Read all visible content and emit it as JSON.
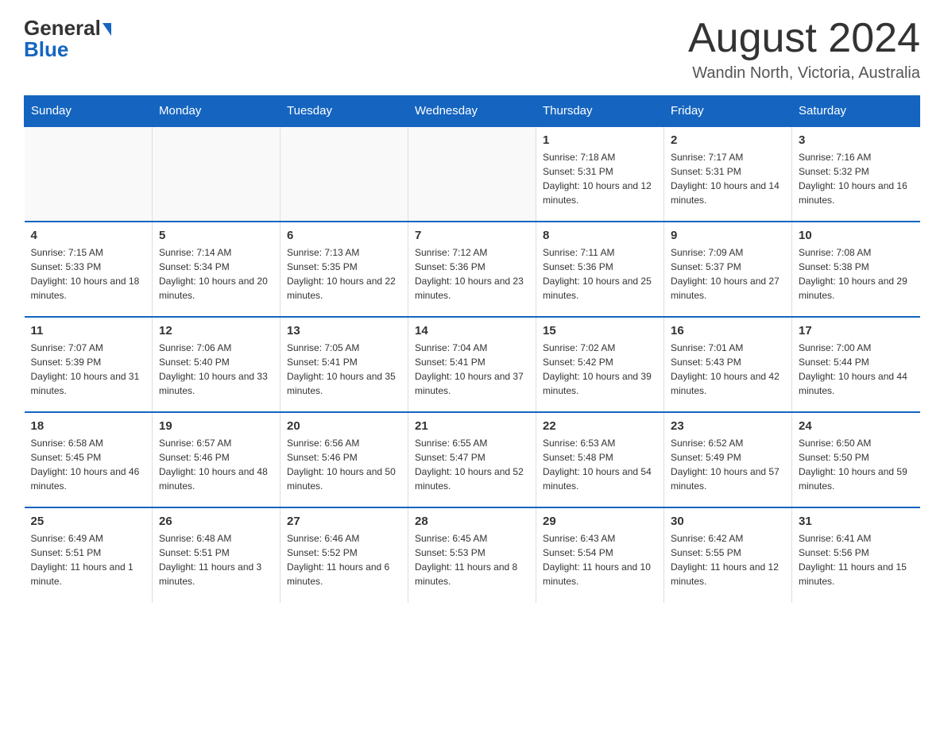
{
  "header": {
    "logo_general": "General",
    "logo_blue": "Blue",
    "month_title": "August 2024",
    "location": "Wandin North, Victoria, Australia"
  },
  "days_of_week": [
    "Sunday",
    "Monday",
    "Tuesday",
    "Wednesday",
    "Thursday",
    "Friday",
    "Saturday"
  ],
  "weeks": [
    {
      "cells": [
        {
          "day": "",
          "sunrise": "",
          "sunset": "",
          "daylight": "",
          "empty": true
        },
        {
          "day": "",
          "sunrise": "",
          "sunset": "",
          "daylight": "",
          "empty": true
        },
        {
          "day": "",
          "sunrise": "",
          "sunset": "",
          "daylight": "",
          "empty": true
        },
        {
          "day": "",
          "sunrise": "",
          "sunset": "",
          "daylight": "",
          "empty": true
        },
        {
          "day": "1",
          "sunrise": "Sunrise: 7:18 AM",
          "sunset": "Sunset: 5:31 PM",
          "daylight": "Daylight: 10 hours and 12 minutes.",
          "empty": false
        },
        {
          "day": "2",
          "sunrise": "Sunrise: 7:17 AM",
          "sunset": "Sunset: 5:31 PM",
          "daylight": "Daylight: 10 hours and 14 minutes.",
          "empty": false
        },
        {
          "day": "3",
          "sunrise": "Sunrise: 7:16 AM",
          "sunset": "Sunset: 5:32 PM",
          "daylight": "Daylight: 10 hours and 16 minutes.",
          "empty": false
        }
      ]
    },
    {
      "cells": [
        {
          "day": "4",
          "sunrise": "Sunrise: 7:15 AM",
          "sunset": "Sunset: 5:33 PM",
          "daylight": "Daylight: 10 hours and 18 minutes.",
          "empty": false
        },
        {
          "day": "5",
          "sunrise": "Sunrise: 7:14 AM",
          "sunset": "Sunset: 5:34 PM",
          "daylight": "Daylight: 10 hours and 20 minutes.",
          "empty": false
        },
        {
          "day": "6",
          "sunrise": "Sunrise: 7:13 AM",
          "sunset": "Sunset: 5:35 PM",
          "daylight": "Daylight: 10 hours and 22 minutes.",
          "empty": false
        },
        {
          "day": "7",
          "sunrise": "Sunrise: 7:12 AM",
          "sunset": "Sunset: 5:36 PM",
          "daylight": "Daylight: 10 hours and 23 minutes.",
          "empty": false
        },
        {
          "day": "8",
          "sunrise": "Sunrise: 7:11 AM",
          "sunset": "Sunset: 5:36 PM",
          "daylight": "Daylight: 10 hours and 25 minutes.",
          "empty": false
        },
        {
          "day": "9",
          "sunrise": "Sunrise: 7:09 AM",
          "sunset": "Sunset: 5:37 PM",
          "daylight": "Daylight: 10 hours and 27 minutes.",
          "empty": false
        },
        {
          "day": "10",
          "sunrise": "Sunrise: 7:08 AM",
          "sunset": "Sunset: 5:38 PM",
          "daylight": "Daylight: 10 hours and 29 minutes.",
          "empty": false
        }
      ]
    },
    {
      "cells": [
        {
          "day": "11",
          "sunrise": "Sunrise: 7:07 AM",
          "sunset": "Sunset: 5:39 PM",
          "daylight": "Daylight: 10 hours and 31 minutes.",
          "empty": false
        },
        {
          "day": "12",
          "sunrise": "Sunrise: 7:06 AM",
          "sunset": "Sunset: 5:40 PM",
          "daylight": "Daylight: 10 hours and 33 minutes.",
          "empty": false
        },
        {
          "day": "13",
          "sunrise": "Sunrise: 7:05 AM",
          "sunset": "Sunset: 5:41 PM",
          "daylight": "Daylight: 10 hours and 35 minutes.",
          "empty": false
        },
        {
          "day": "14",
          "sunrise": "Sunrise: 7:04 AM",
          "sunset": "Sunset: 5:41 PM",
          "daylight": "Daylight: 10 hours and 37 minutes.",
          "empty": false
        },
        {
          "day": "15",
          "sunrise": "Sunrise: 7:02 AM",
          "sunset": "Sunset: 5:42 PM",
          "daylight": "Daylight: 10 hours and 39 minutes.",
          "empty": false
        },
        {
          "day": "16",
          "sunrise": "Sunrise: 7:01 AM",
          "sunset": "Sunset: 5:43 PM",
          "daylight": "Daylight: 10 hours and 42 minutes.",
          "empty": false
        },
        {
          "day": "17",
          "sunrise": "Sunrise: 7:00 AM",
          "sunset": "Sunset: 5:44 PM",
          "daylight": "Daylight: 10 hours and 44 minutes.",
          "empty": false
        }
      ]
    },
    {
      "cells": [
        {
          "day": "18",
          "sunrise": "Sunrise: 6:58 AM",
          "sunset": "Sunset: 5:45 PM",
          "daylight": "Daylight: 10 hours and 46 minutes.",
          "empty": false
        },
        {
          "day": "19",
          "sunrise": "Sunrise: 6:57 AM",
          "sunset": "Sunset: 5:46 PM",
          "daylight": "Daylight: 10 hours and 48 minutes.",
          "empty": false
        },
        {
          "day": "20",
          "sunrise": "Sunrise: 6:56 AM",
          "sunset": "Sunset: 5:46 PM",
          "daylight": "Daylight: 10 hours and 50 minutes.",
          "empty": false
        },
        {
          "day": "21",
          "sunrise": "Sunrise: 6:55 AM",
          "sunset": "Sunset: 5:47 PM",
          "daylight": "Daylight: 10 hours and 52 minutes.",
          "empty": false
        },
        {
          "day": "22",
          "sunrise": "Sunrise: 6:53 AM",
          "sunset": "Sunset: 5:48 PM",
          "daylight": "Daylight: 10 hours and 54 minutes.",
          "empty": false
        },
        {
          "day": "23",
          "sunrise": "Sunrise: 6:52 AM",
          "sunset": "Sunset: 5:49 PM",
          "daylight": "Daylight: 10 hours and 57 minutes.",
          "empty": false
        },
        {
          "day": "24",
          "sunrise": "Sunrise: 6:50 AM",
          "sunset": "Sunset: 5:50 PM",
          "daylight": "Daylight: 10 hours and 59 minutes.",
          "empty": false
        }
      ]
    },
    {
      "cells": [
        {
          "day": "25",
          "sunrise": "Sunrise: 6:49 AM",
          "sunset": "Sunset: 5:51 PM",
          "daylight": "Daylight: 11 hours and 1 minute.",
          "empty": false
        },
        {
          "day": "26",
          "sunrise": "Sunrise: 6:48 AM",
          "sunset": "Sunset: 5:51 PM",
          "daylight": "Daylight: 11 hours and 3 minutes.",
          "empty": false
        },
        {
          "day": "27",
          "sunrise": "Sunrise: 6:46 AM",
          "sunset": "Sunset: 5:52 PM",
          "daylight": "Daylight: 11 hours and 6 minutes.",
          "empty": false
        },
        {
          "day": "28",
          "sunrise": "Sunrise: 6:45 AM",
          "sunset": "Sunset: 5:53 PM",
          "daylight": "Daylight: 11 hours and 8 minutes.",
          "empty": false
        },
        {
          "day": "29",
          "sunrise": "Sunrise: 6:43 AM",
          "sunset": "Sunset: 5:54 PM",
          "daylight": "Daylight: 11 hours and 10 minutes.",
          "empty": false
        },
        {
          "day": "30",
          "sunrise": "Sunrise: 6:42 AM",
          "sunset": "Sunset: 5:55 PM",
          "daylight": "Daylight: 11 hours and 12 minutes.",
          "empty": false
        },
        {
          "day": "31",
          "sunrise": "Sunrise: 6:41 AM",
          "sunset": "Sunset: 5:56 PM",
          "daylight": "Daylight: 11 hours and 15 minutes.",
          "empty": false
        }
      ]
    }
  ]
}
